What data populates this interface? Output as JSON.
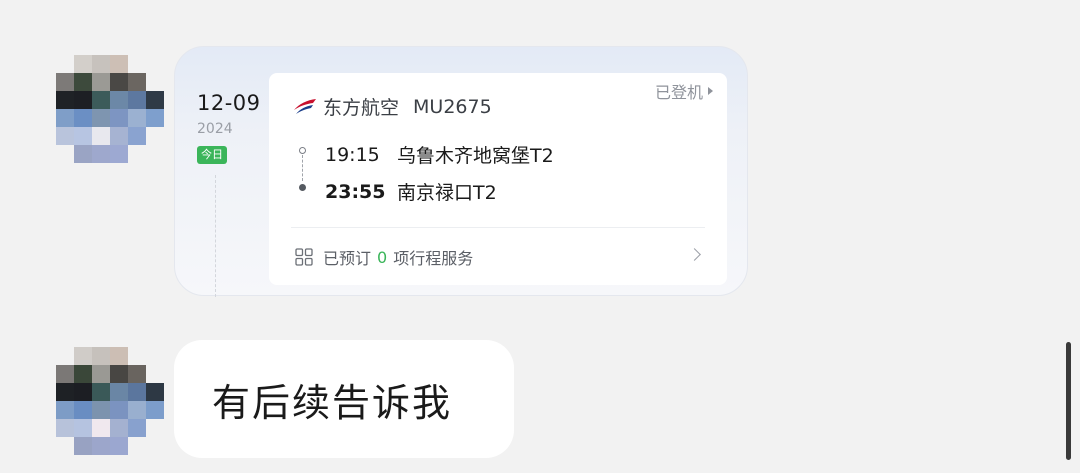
{
  "flight_card": {
    "date": "12-09",
    "year": "2024",
    "today_badge": "今日",
    "status": "已登机",
    "airline": "东方航空",
    "flight_number": "MU2675",
    "departure_time": "19:15",
    "departure_airport": "乌鲁木齐地窝堡T2",
    "arrival_time": "23:55",
    "arrival_airport": "南京禄口T2",
    "services_prefix": "已预订",
    "services_count": "0",
    "services_suffix": "项行程服务",
    "colors": {
      "airline_red": "#c8102e",
      "airline_blue": "#1b3f8b",
      "green": "#3bb55a"
    }
  },
  "message": {
    "text": "有后续告诉我"
  },
  "icons": {
    "airline_logo": "china-eastern-logo-icon",
    "status_arrow": "triangle-right-icon",
    "services": "grid-icon",
    "chevron": "chevron-right-icon"
  }
}
